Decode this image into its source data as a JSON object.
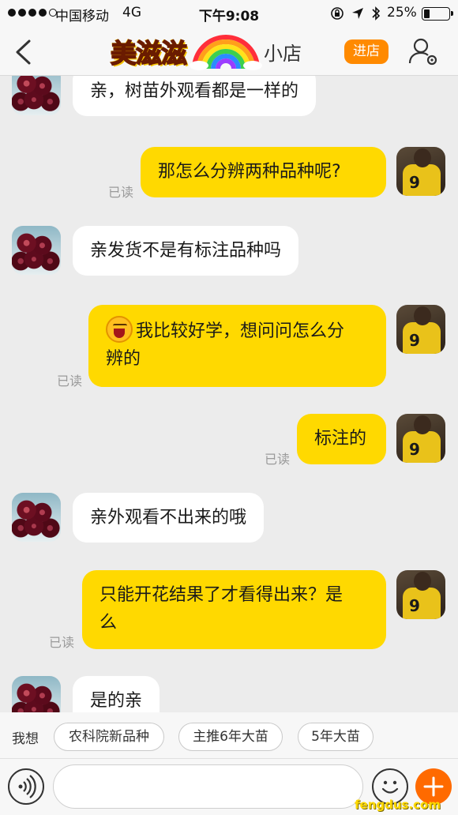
{
  "status_bar": {
    "carrier": "中国移动",
    "network": "4G",
    "time": "下午9:08",
    "battery": "25%",
    "battery_level": 0.25
  },
  "header": {
    "shop_name": "美滋滋",
    "shop_suffix": "小店",
    "enter_shop_label": "进店"
  },
  "messages": [
    {
      "side": "in",
      "text": "亲，树苗外观看都是一样的"
    },
    {
      "side": "out",
      "text": "那怎么分辨两种品种呢?",
      "read": "已读"
    },
    {
      "side": "in",
      "text": "亲发货不是有标注品种吗"
    },
    {
      "side": "out",
      "line1": "我比较好学，想问问怎么分",
      "line2": "辨的",
      "read": "已读"
    },
    {
      "side": "out",
      "text": "标注的",
      "read": "已读"
    },
    {
      "side": "in",
      "text": "亲外观看不出来的哦"
    },
    {
      "side": "out",
      "line1": "只能开花结果了才看得出来？是",
      "line2": "么",
      "read": "已读"
    },
    {
      "side": "in",
      "text": "是的亲"
    }
  ],
  "quick_replies": {
    "label": "我想",
    "chips": [
      "农科院新品种",
      "主推6年大苗",
      "5年大苗"
    ]
  },
  "input": {
    "placeholder": ""
  },
  "watermark": "fengdus.com",
  "colors": {
    "accent_orange": "#ff8a00",
    "outgoing_bubble": "#ffd900",
    "incoming_bubble": "#ffffff",
    "background": "#ececec"
  }
}
